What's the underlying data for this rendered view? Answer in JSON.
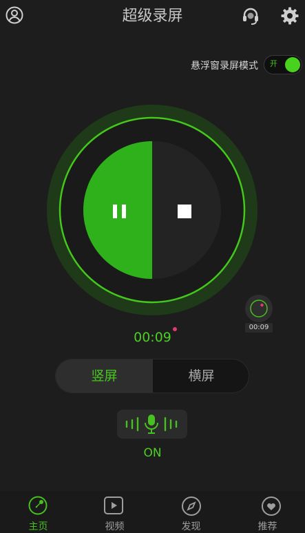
{
  "header": {
    "title": "超级录屏",
    "icons": [
      "user-icon",
      "headset-icon",
      "gear-icon"
    ]
  },
  "floating_mode": {
    "label": "悬浮窗录屏模式",
    "toggle_text": "开",
    "enabled": true
  },
  "recorder": {
    "timer": "00:09",
    "pause_icon": "pause-icon",
    "stop_icon": "stop-icon",
    "mini_widget_time": "00:09"
  },
  "orientation": {
    "options": [
      "竖屏",
      "横屏"
    ],
    "selected": "竖屏"
  },
  "audio": {
    "icon": "microphone-icon",
    "state": "ON"
  },
  "bottom_nav": {
    "items": [
      {
        "label": "主页",
        "icon": "home-dial-icon",
        "active": true
      },
      {
        "label": "视频",
        "icon": "play-icon",
        "active": false
      },
      {
        "label": "发现",
        "icon": "compass-icon",
        "active": false
      },
      {
        "label": "推荐",
        "icon": "heart-icon",
        "active": false
      }
    ]
  },
  "colors": {
    "accent": "#46c11f",
    "background": "#1d1d1d",
    "record_dot": "#e33a6c"
  }
}
